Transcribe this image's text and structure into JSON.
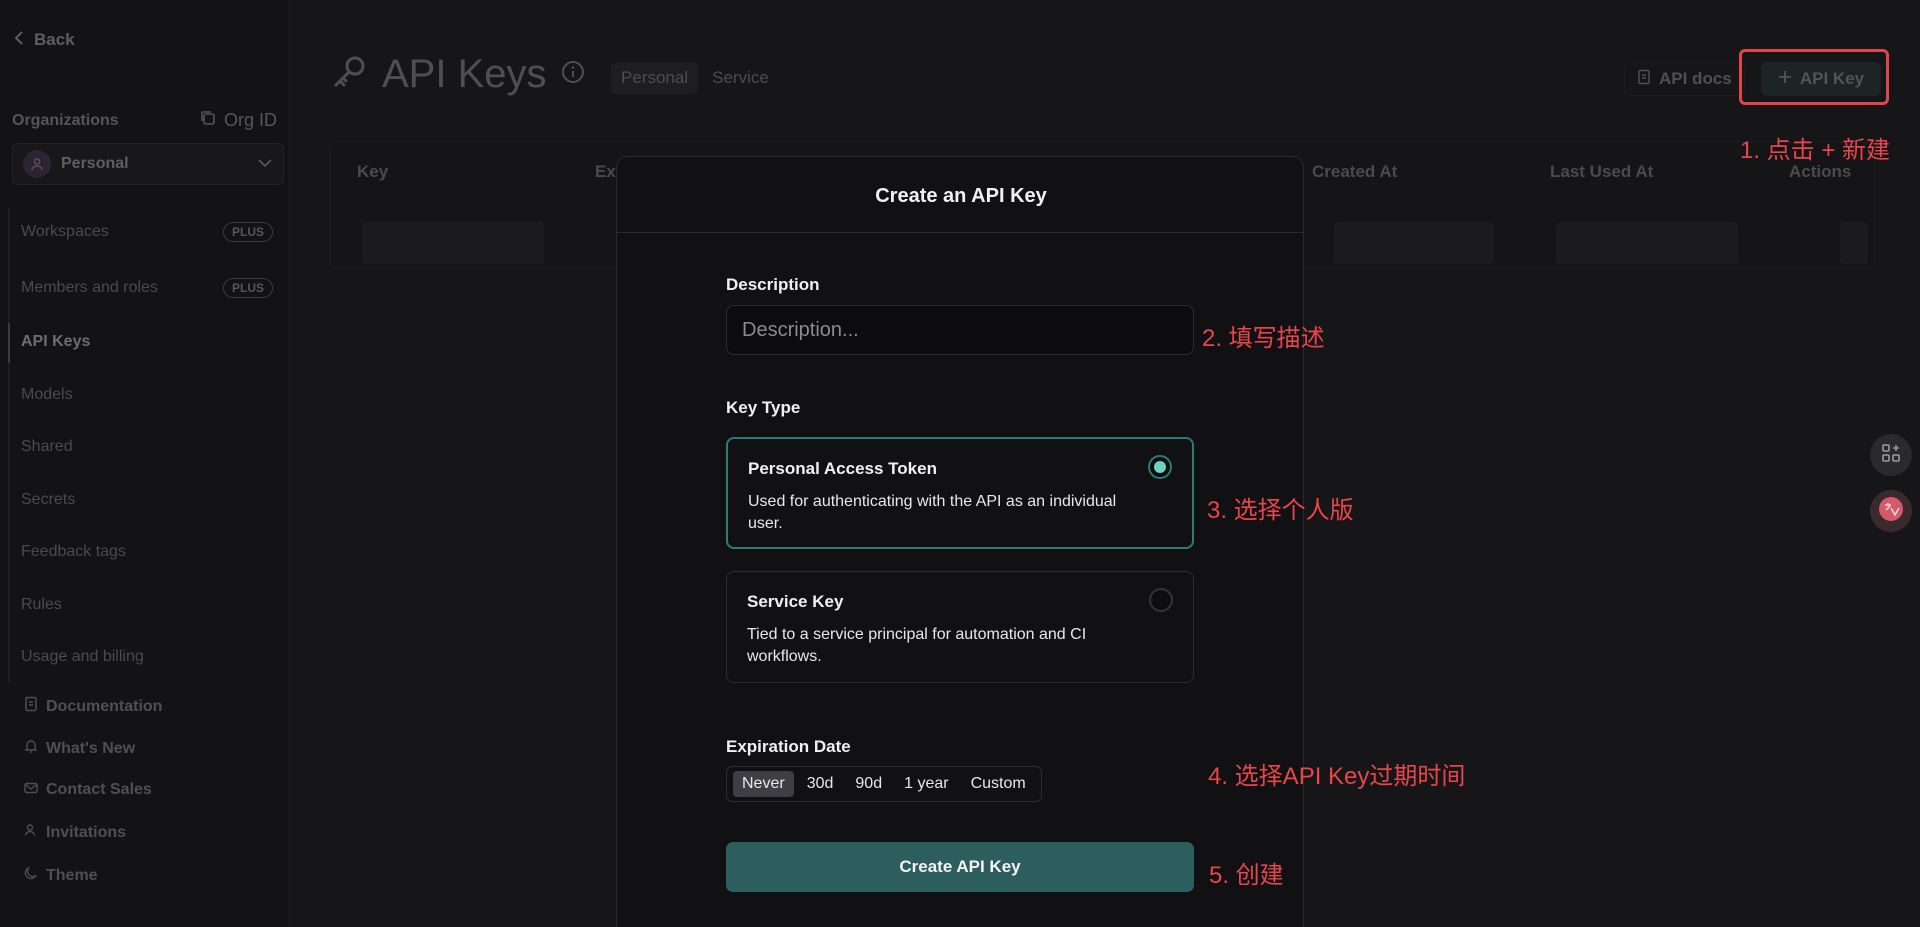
{
  "sidebar": {
    "back": "Back",
    "organizations_title": "Organizations",
    "org_id": "Org ID",
    "org_selected": "Personal",
    "items": [
      {
        "label": "Workspaces",
        "badge": "PLUS"
      },
      {
        "label": "Members and roles",
        "badge": "PLUS"
      },
      {
        "label": "API Keys"
      },
      {
        "label": "Models"
      },
      {
        "label": "Shared"
      },
      {
        "label": "Secrets"
      },
      {
        "label": "Feedback tags"
      },
      {
        "label": "Rules"
      },
      {
        "label": "Usage and billing"
      }
    ],
    "bottom": [
      "Documentation",
      "What's New",
      "Contact Sales",
      "Invitations",
      "Theme"
    ]
  },
  "header": {
    "title": "API Keys",
    "tabs": [
      "Personal",
      "Service"
    ],
    "api_docs": "API docs",
    "add_key": "API Key"
  },
  "table": {
    "columns": [
      "Key",
      "Ex",
      "Created At",
      "Last Used At",
      "Actions"
    ]
  },
  "modal": {
    "title": "Create an API Key",
    "description_label": "Description",
    "description_placeholder": "Description...",
    "key_type_label": "Key Type",
    "key_types": [
      {
        "title": "Personal Access Token",
        "desc": "Used for authenticating with the API as an individual user.",
        "selected": true
      },
      {
        "title": "Service Key",
        "desc": "Tied to a service principal for automation and CI workflows.",
        "selected": false
      }
    ],
    "expiration_label": "Expiration Date",
    "expiration_options": [
      "Never",
      "30d",
      "90d",
      "1 year",
      "Custom"
    ],
    "expiration_selected": "Never",
    "submit": "Create API Key"
  },
  "annotations": {
    "a1": "1. 点击 + 新建",
    "a2": "2. 填写描述",
    "a3": "3. 选择个人版",
    "a4": "4. 选择API Key过期时间",
    "a5": "5. 创建"
  },
  "colors": {
    "accent": "#2c5e5d",
    "annotation": "#e8454c"
  }
}
